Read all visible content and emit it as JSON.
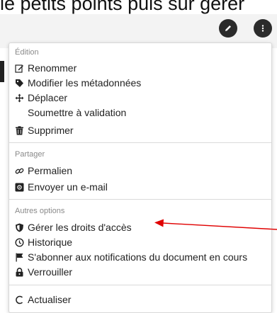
{
  "top_text": "le petits points puis sur gérer",
  "buttons": {
    "edit_icon": "pencil-icon",
    "more_icon": "more-vertical-icon"
  },
  "menu": {
    "sections": [
      {
        "title": "Édition",
        "items": [
          {
            "label": "Renommer",
            "icon": "rename-icon"
          },
          {
            "label": "Modifier les métadonnées",
            "icon": "tag-icon"
          },
          {
            "label": "Déplacer",
            "icon": "move-icon"
          },
          {
            "label": "Soumettre à validation",
            "icon": ""
          },
          {
            "label": "Supprimer",
            "icon": "trash-icon"
          }
        ]
      },
      {
        "title": "Partager",
        "items": [
          {
            "label": "Permalien",
            "icon": "link-icon"
          },
          {
            "label": "Envoyer un e-mail",
            "icon": "email-icon"
          }
        ]
      },
      {
        "title": "Autres options",
        "items": [
          {
            "label": "Gérer les droits d'accès",
            "icon": "shield-icon"
          },
          {
            "label": "Historique",
            "icon": "history-icon"
          },
          {
            "label": "S'abonner aux notifications du document en cours",
            "icon": "flag-icon"
          },
          {
            "label": "Verrouiller",
            "icon": "lock-icon"
          }
        ]
      },
      {
        "title": "",
        "items": [
          {
            "label": "Actualiser",
            "icon": "refresh-icon"
          }
        ]
      }
    ]
  },
  "colors": {
    "annotation_arrow": "#e00000",
    "button_bg": "#2b2b2b"
  }
}
